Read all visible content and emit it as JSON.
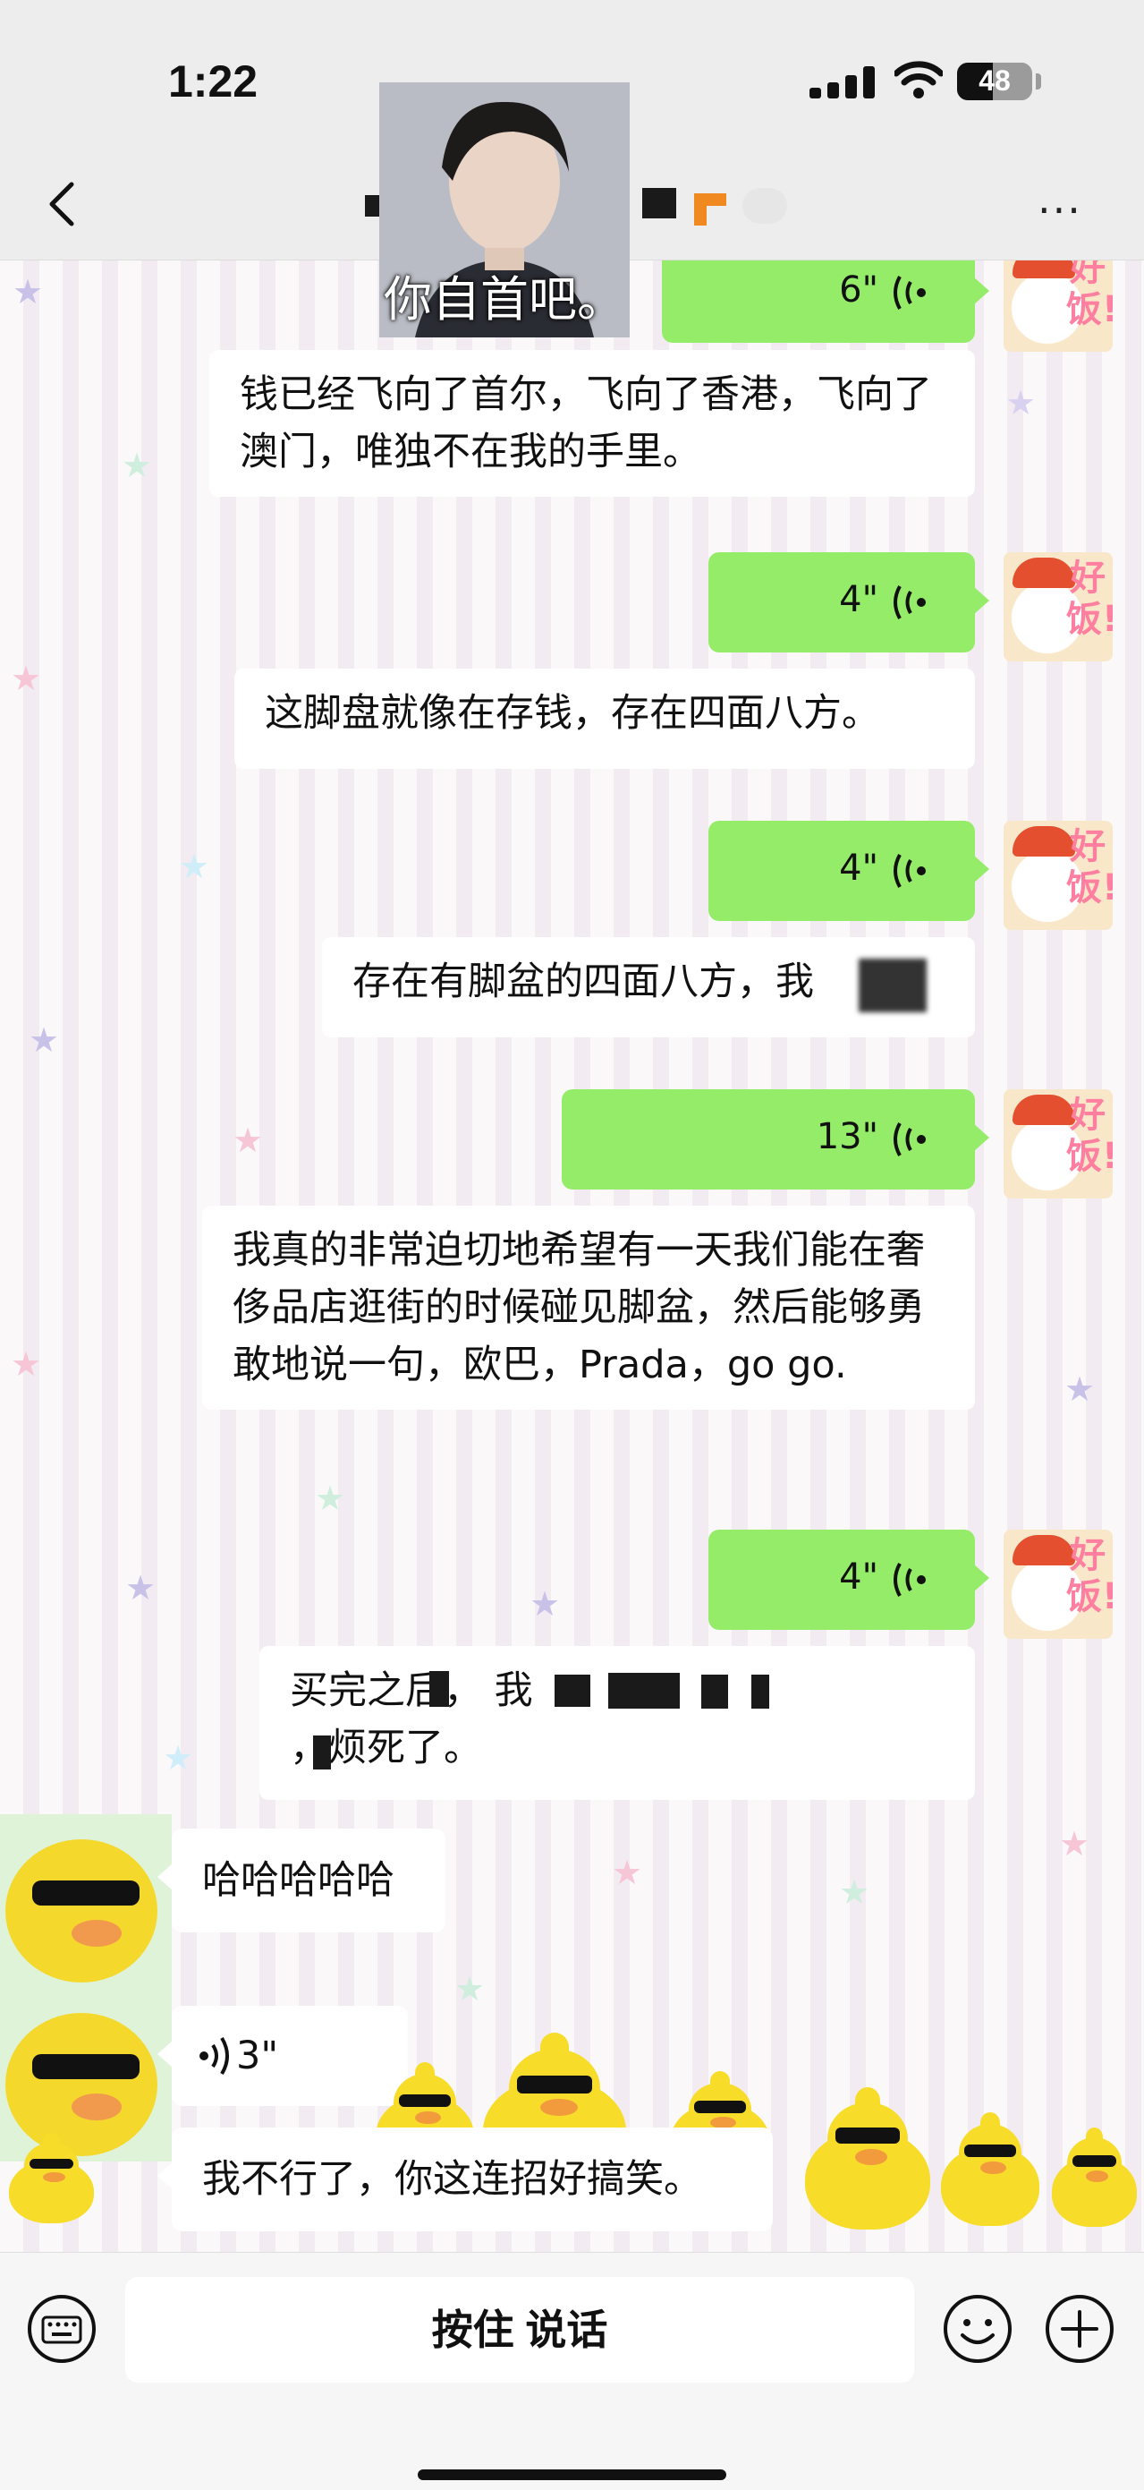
{
  "status_bar": {
    "time": "1:22",
    "battery": "48",
    "battery_level": 0.48
  },
  "nav": {
    "title_obscured": true,
    "more": "···"
  },
  "profile_photo": {
    "caption": "你自首吧。"
  },
  "messages": [
    {
      "type": "voice",
      "duration": "6\""
    },
    {
      "type": "transcript",
      "text": "钱已经飞向了首尔，飞向了香港，飞向了澳门，唯独不在我的手里。"
    },
    {
      "type": "voice",
      "duration": "4\""
    },
    {
      "type": "transcript",
      "text": "这脚盘就像在存钱，存在四面八方。"
    },
    {
      "type": "voice",
      "duration": "4\""
    },
    {
      "type": "transcript",
      "text": "存在有脚盆的四面八方，我"
    },
    {
      "type": "voice",
      "duration": "13\""
    },
    {
      "type": "transcript",
      "text": "我真的非常迫切地希望有一天我们能在奢侈品店逛街的时候碰见脚盆，然后能够勇敢地说一句，欧巴，Prada，go go."
    },
    {
      "type": "voice",
      "duration": "4\""
    },
    {
      "type": "transcript",
      "text": "买完之后，               我",
      "text2": "，烦死了。"
    },
    {
      "type": "text_in",
      "text": "哈哈哈哈哈"
    },
    {
      "type": "voice_in",
      "duration": "3\""
    },
    {
      "type": "text_in",
      "text": "我不行了，你这连招好搞笑。"
    }
  ],
  "avatar_me": {
    "text": "好饭!"
  },
  "input_bar": {
    "hold_to_talk": "按住 说话"
  },
  "colors": {
    "voice_bubble": "#95ec69",
    "bar_bg": "#ededed"
  },
  "icons": [
    "keyboard-icon",
    "emoji-icon",
    "plus-icon",
    "back-icon",
    "voice-wave-icon"
  ]
}
